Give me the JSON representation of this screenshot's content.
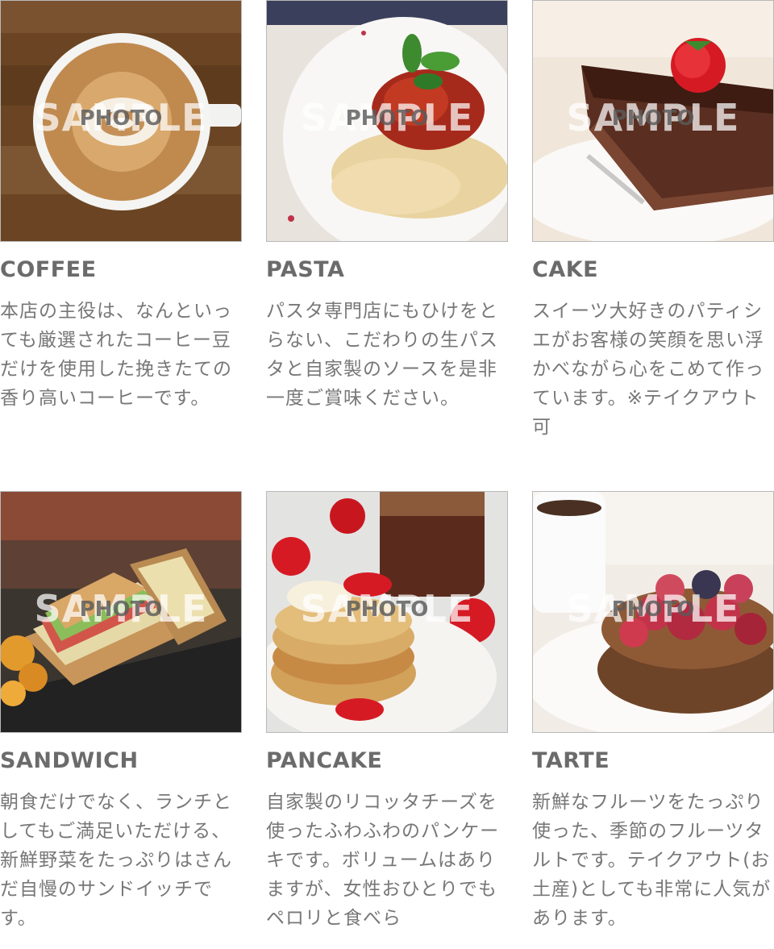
{
  "watermark": {
    "big": "SAMPLE",
    "small": "PHOTO"
  },
  "items": [
    {
      "title": "COFFEE",
      "desc": "本店の主役は、なんといっても厳選されたコーヒー豆だけを使用した挽きたての香り高いコーヒーです。",
      "photo_icon": "coffee-cup-photo"
    },
    {
      "title": "PASTA",
      "desc": "パスタ専門店にもひけをとらない、こだわりの生パスタと自家製のソースを是非一度ご賞味ください。",
      "photo_icon": "pasta-plate-photo"
    },
    {
      "title": "CAKE",
      "desc": "スイーツ大好きのパティシエがお客様の笑顔を思い浮かべながら心をこめて作っています。※テイクアウト可",
      "photo_icon": "chocolate-cake-photo"
    },
    {
      "title": "SANDWICH",
      "desc": "朝食だけでなく、ランチとしてもご満足いただける、新鮮野菜をたっぷりはさんだ自慢のサンドイッチです。",
      "photo_icon": "sandwich-photo"
    },
    {
      "title": "PANCAKE",
      "desc": "自家製のリコッタチーズを使ったふわふわのパンケーキです。ボリュームはありますが、女性おひとりでもペロリと食べら",
      "photo_icon": "pancake-photo"
    },
    {
      "title": "TARTE",
      "desc": "新鮮なフルーツをたっぷり使った、季節のフルーツタルトです。テイクアウト(お土産)としても非常に人気があります。",
      "photo_icon": "berry-tarte-photo"
    }
  ]
}
